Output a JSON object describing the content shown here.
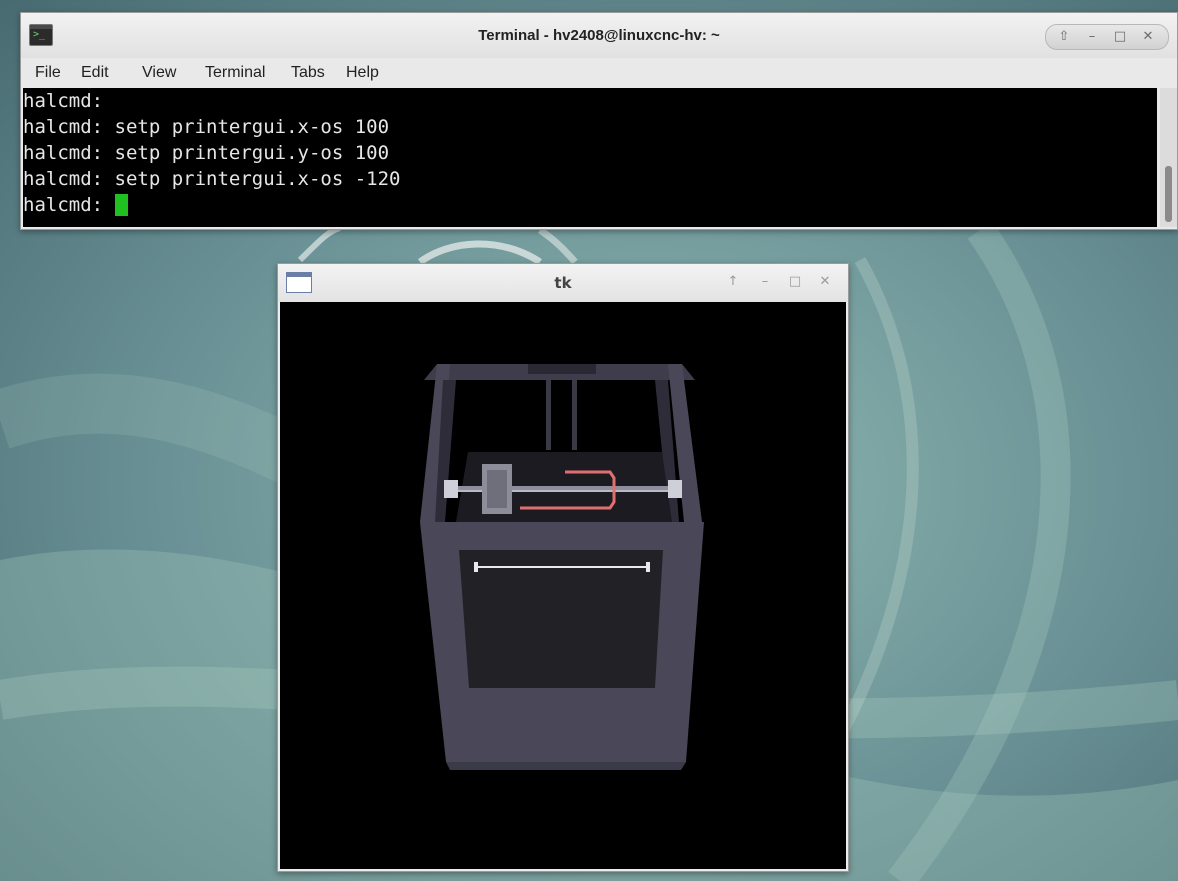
{
  "terminal": {
    "title": "Terminal - hv2408@linuxcnc-hv: ~",
    "menu": [
      "File",
      "Edit",
      "View",
      "Terminal",
      "Tabs",
      "Help"
    ],
    "lines": [
      "halcmd:",
      "halcmd: setp printergui.x-os 100",
      "halcmd: setp printergui.y-os 100",
      "halcmd: setp printergui.x-os -120",
      "halcmd: "
    ],
    "controls": {
      "shade": "⇧",
      "minimize": "–",
      "maximize": "□",
      "close": "✕"
    }
  },
  "tk_window": {
    "title": "tk",
    "controls": {
      "shade": "↑",
      "minimize": "–",
      "maximize": "□",
      "close": "✕"
    }
  },
  "colors": {
    "desktop_base": "#5f8a8f",
    "cursor": "#1fc01f",
    "frame": "#4a4858",
    "filament": "#e07070"
  }
}
